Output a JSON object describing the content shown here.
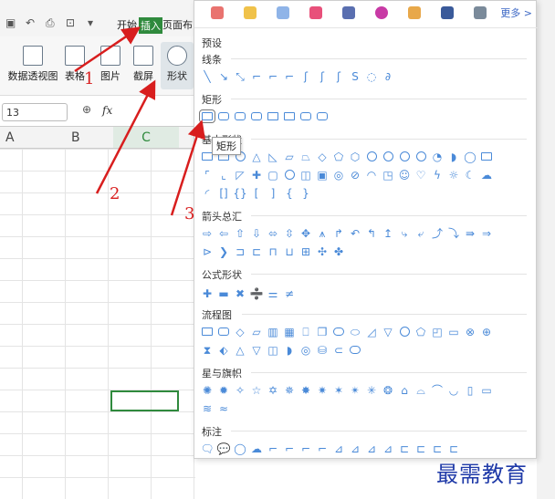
{
  "app": {
    "tabs": [
      {
        "label": "开始",
        "active": false
      },
      {
        "label": "插入",
        "active": true
      },
      {
        "label": "页面布",
        "active": false
      }
    ],
    "accent_color": "#2f8a3d"
  },
  "ribbon": {
    "buttons": [
      {
        "label": "数据透视图"
      },
      {
        "label": "表格"
      },
      {
        "label": "图片"
      },
      {
        "label": "截屏"
      },
      {
        "label": "形状"
      }
    ]
  },
  "formula_bar": {
    "name_box": "13",
    "fx": "fx"
  },
  "columns": [
    "A",
    "B",
    "C"
  ],
  "shapes_panel": {
    "more_label": "更多 >",
    "sections": [
      {
        "title": "预设"
      },
      {
        "title": "线条"
      },
      {
        "title": "矩形"
      },
      {
        "title": "基本形状"
      },
      {
        "title": "箭头总汇"
      },
      {
        "title": "公式形状"
      },
      {
        "title": "流程图"
      },
      {
        "title": "星与旗帜"
      },
      {
        "title": "标注"
      }
    ],
    "tooltip": "矩形"
  },
  "annotations": {
    "n1": "1",
    "n2": "2",
    "n3": "3",
    "arrow_color": "#d81e1e"
  },
  "watermark": "最需教育"
}
